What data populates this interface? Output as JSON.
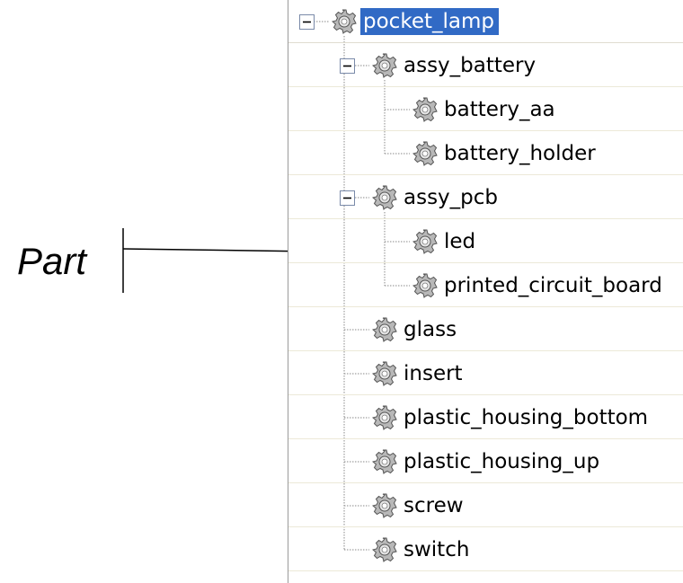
{
  "callout": {
    "text": "Part"
  },
  "tree": {
    "items": [
      {
        "label": "pocket_lamp",
        "depth": 0,
        "expander": "collapse",
        "selected": true
      },
      {
        "label": "assy_battery",
        "depth": 1,
        "expander": "collapse"
      },
      {
        "label": "battery_aa",
        "depth": 2
      },
      {
        "label": "battery_holder",
        "depth": 2
      },
      {
        "label": "assy_pcb",
        "depth": 1,
        "expander": "collapse"
      },
      {
        "label": "led",
        "depth": 2
      },
      {
        "label": "printed_circuit_board",
        "depth": 2
      },
      {
        "label": "glass",
        "depth": 1
      },
      {
        "label": "insert",
        "depth": 1
      },
      {
        "label": "plastic_housing_bottom",
        "depth": 1
      },
      {
        "label": "plastic_housing_up",
        "depth": 1
      },
      {
        "label": "screw",
        "depth": 1
      },
      {
        "label": "switch",
        "depth": 1
      }
    ],
    "icon": "gear-icon",
    "selection_color": "#316ac5"
  }
}
